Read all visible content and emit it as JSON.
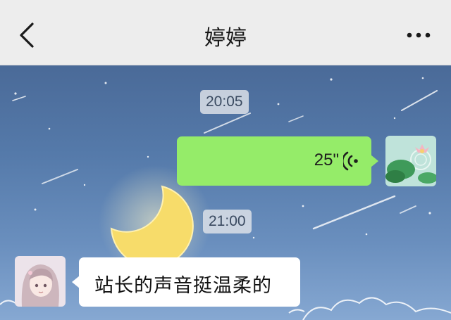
{
  "header": {
    "title": "婷婷"
  },
  "icons": {
    "back": "chevron-left-icon",
    "more": "more-dots-icon",
    "voice": "voice-wave-icon"
  },
  "chat": {
    "timestamps": [
      "20:05",
      "21:00"
    ],
    "voice_message": {
      "duration": "25\""
    },
    "text_message": {
      "text": "站长的声音挺温柔的"
    }
  },
  "colors": {
    "header_bg": "#ededed",
    "outgoing_bubble": "#95ec69",
    "incoming_bubble": "#ffffff",
    "chat_bg": "#557aaa"
  }
}
